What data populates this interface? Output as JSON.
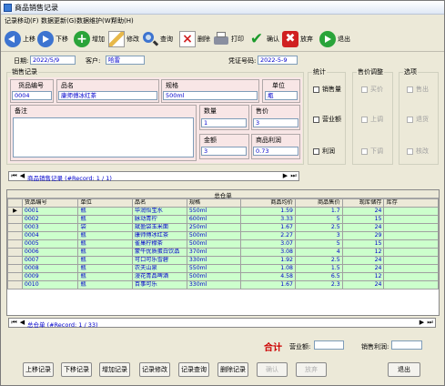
{
  "window": {
    "title": "商品销售记录"
  },
  "menu": [
    "记录移动(F)",
    "数据更新(G)",
    "数据维护(W)",
    "帮助(H)"
  ],
  "toolbar": {
    "prev": "上移",
    "next": "下移",
    "add": "增加",
    "edit": "修改",
    "query": "查询",
    "delete": "删除",
    "print": "打印",
    "confirm": "确认",
    "abandon": "放弃",
    "exit": "退出"
  },
  "header": {
    "date_label": "日期:",
    "date_value": "2022/5/9",
    "customer_label": "客户:",
    "customer_value": "哈雷",
    "voucher_label": "凭证号码:",
    "voucher_value": "2022-5-9"
  },
  "record": {
    "group_title": "销售记录",
    "code_label": "货品编号",
    "code_value": "0004",
    "name_label": "品名",
    "name_value": "康师傅冰红茶",
    "spec_label": "规格",
    "spec_value": "500ml",
    "unit_label": "单位",
    "unit_value": "瓶",
    "note_label": "备注",
    "note_value": "",
    "qty_label": "数量",
    "qty_value": "1",
    "price_label": "售价",
    "price_value": "3",
    "amount_label": "金额",
    "amount_value": "3",
    "profit_label": "商品利润",
    "profit_value": "0.73"
  },
  "stats": {
    "title": "统计",
    "items": [
      "销售量",
      "营业额",
      "利润"
    ]
  },
  "adjust": {
    "title": "售价调整",
    "items": [
      "买价",
      "上调",
      "下调"
    ]
  },
  "options": {
    "title": "选项",
    "items": [
      "售出",
      "退货",
      "核改"
    ]
  },
  "nav_top": {
    "text": "商品销售记录 (#Record: 1 / 1)"
  },
  "grid": {
    "title": "总仓单",
    "columns": [
      "货品编号",
      "单位",
      "品名",
      "规格",
      "商品均价",
      "商品售价",
      "现库储存",
      "库存"
    ],
    "rows": [
      [
        "0001",
        "瓶",
        "华润怡宝水",
        "550ml",
        "1.59",
        "1.7",
        "24"
      ],
      [
        "0002",
        "瓶",
        "脉动青柠",
        "600ml",
        "3.33",
        "5",
        "15"
      ],
      [
        "0003",
        "袋",
        "斌盈袋玉米面",
        "250ml",
        "1.67",
        "2.5",
        "24"
      ],
      [
        "0004",
        "瓶",
        "康师傅冰红茶",
        "500ml",
        "2.27",
        "3",
        "29"
      ],
      [
        "0005",
        "瓶",
        "雀巢柠檬茶",
        "500ml",
        "3.07",
        "5",
        "15"
      ],
      [
        "0006",
        "瓶",
        "蒙牛优质蛋白饮品",
        "370ml",
        "3.08",
        "4",
        "12"
      ],
      [
        "0007",
        "瓶",
        "可口可乐雪碧",
        "330ml",
        "1.92",
        "2.5",
        "24"
      ],
      [
        "0008",
        "瓶",
        "农夫山泉",
        "550ml",
        "1.08",
        "1.5",
        "24"
      ],
      [
        "0009",
        "瓶",
        "漫花青品啤酒",
        "500ml",
        "4.58",
        "6.5",
        "12"
      ],
      [
        "0010",
        "瓶",
        "百事可乐",
        "330ml",
        "1.67",
        "2.3",
        "24"
      ]
    ]
  },
  "nav_bottom": {
    "text": "总仓单 (#Record: 1 / 33)"
  },
  "totals": {
    "label": "合计",
    "revenue_label": "营业额:",
    "profit_label": "销售利润:"
  },
  "buttons": [
    "上移记录",
    "下移记录",
    "增加记录",
    "记录修改",
    "记录查询",
    "删除记录",
    "确认",
    "放弃",
    "退出"
  ],
  "colors": {
    "accent": "#cc0000",
    "grid_row": "#ccffcc",
    "field_text": "#0000cc"
  }
}
